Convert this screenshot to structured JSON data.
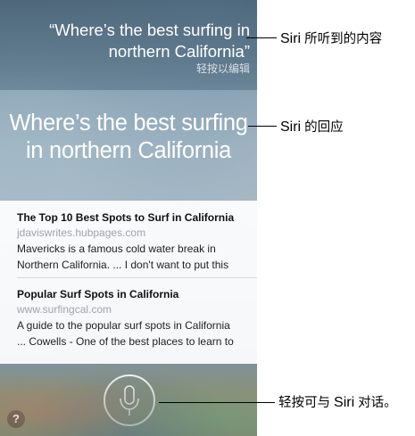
{
  "siri_screen": {
    "heard_text": "“Where’s the best surfing in northern California”",
    "tap_to_edit": "轻按以编辑",
    "answer_text": "Where’s the best surfing in northern California",
    "results": [
      {
        "title": "The Top 10 Best Spots to Surf in California",
        "url": "jdaviswrites.hubpages.com",
        "snippet_line1": "Mavericks is a famous cold water break in",
        "snippet_line2": "Northern California. ... I don't want to put this"
      },
      {
        "title": "Popular Surf Spots in California",
        "url": "www.surfingcal.com",
        "snippet_line1": "A guide to the popular surf spots in California",
        "snippet_line2": "... Cowells - One of the best places to learn to"
      }
    ],
    "help_label": "?",
    "mic_icon": "microphone-icon"
  },
  "callouts": {
    "heard": {
      "latin": "Siri",
      "text": " 所听到的内容"
    },
    "response": {
      "latin": "Siri",
      "text": " 的回应"
    },
    "talk": {
      "prefix": "轻按可与 ",
      "latin": "Siri",
      "suffix": " 对话。"
    }
  },
  "colors": {
    "result_url": "#a0a4a8",
    "callout_line": "#000000"
  }
}
